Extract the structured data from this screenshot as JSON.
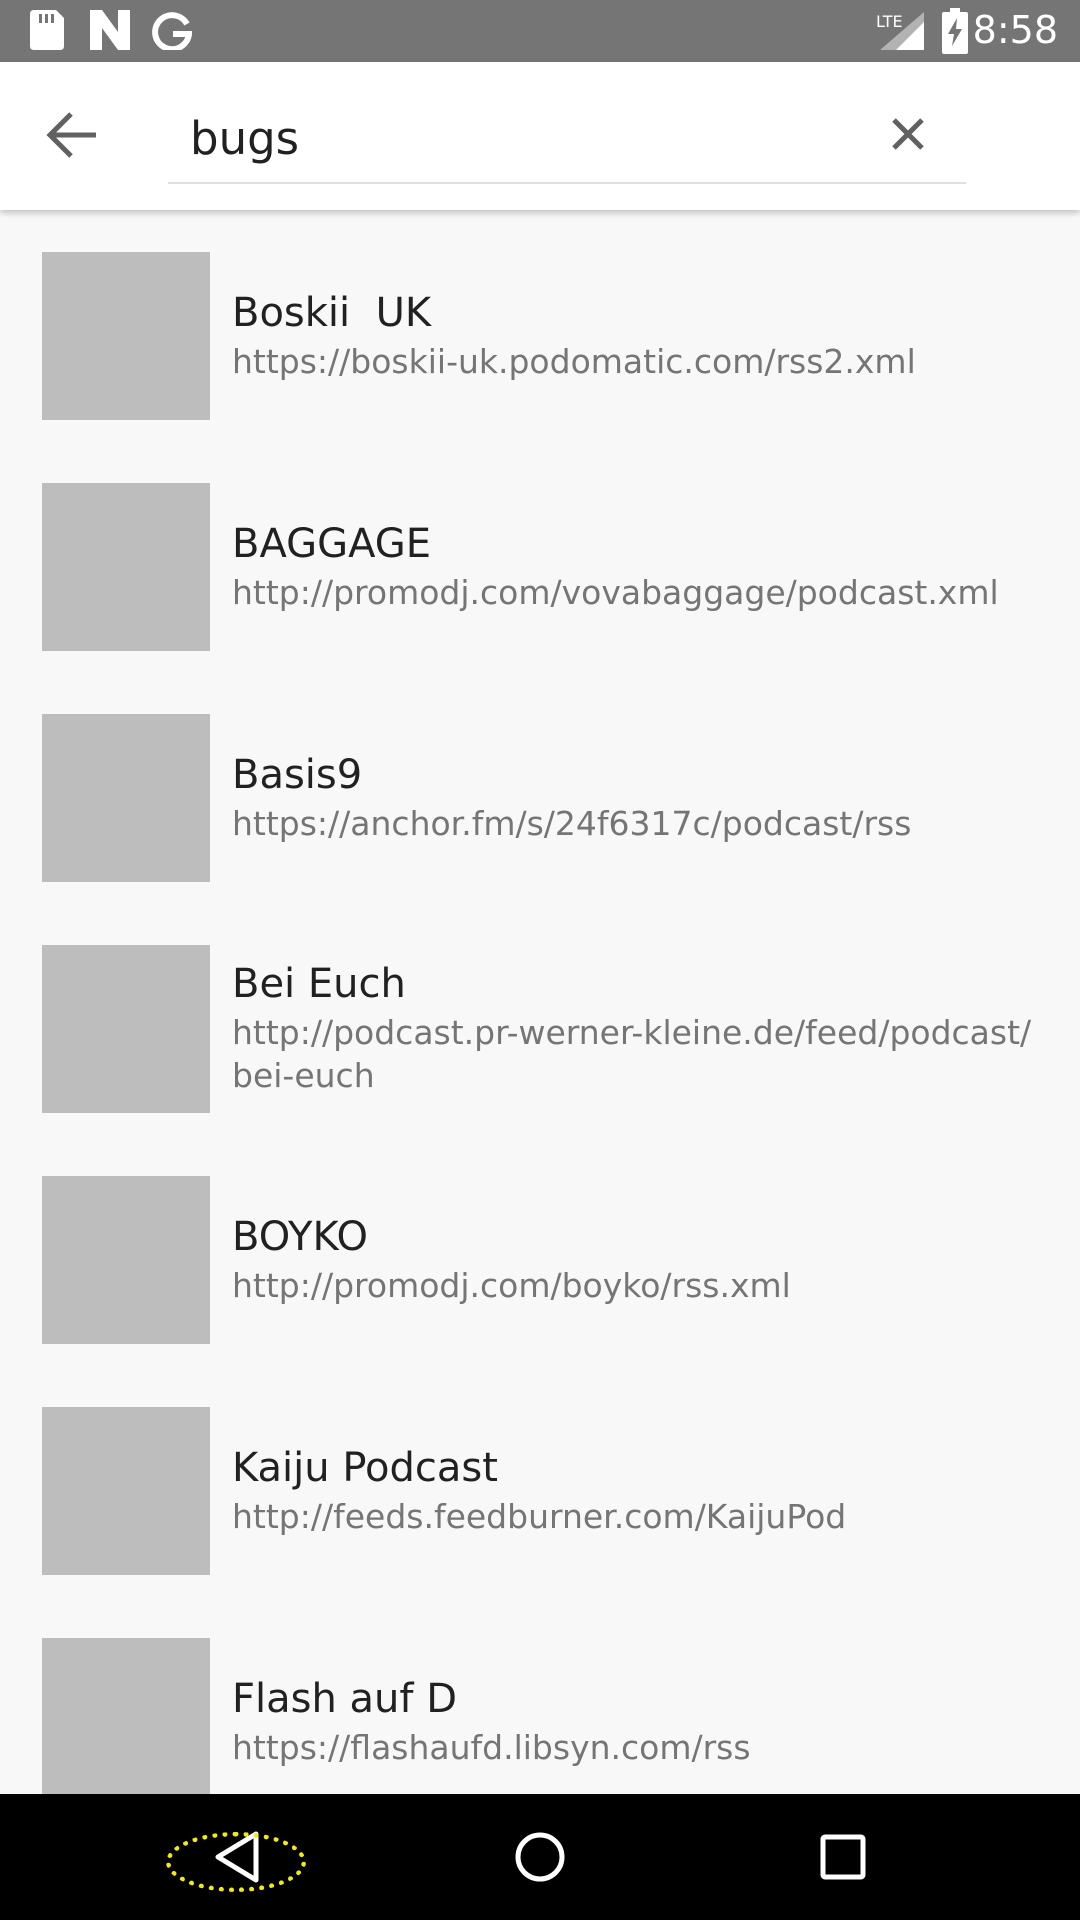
{
  "status_bar": {
    "time": "8:58",
    "network": "LTE",
    "left_icons": [
      "sd-card-icon",
      "n-notification-icon",
      "google-icon"
    ],
    "right_icons": [
      "signal-icon",
      "battery-charging-icon"
    ]
  },
  "search": {
    "query": "bugs",
    "back_icon": "arrow-back-icon",
    "clear_icon": "close-icon"
  },
  "results": [
    {
      "title": "Boskii  UK",
      "url": "https://boskii-uk.podomatic.com/rss2.xml"
    },
    {
      "title": "BAGGAGE",
      "url": "http://promodj.com/vovabaggage/podcast.xml"
    },
    {
      "title": "Basis9",
      "url": "https://anchor.fm/s/24f6317c/podcast/rss"
    },
    {
      "title": "Bei Euch",
      "url": "http://podcast.pr-werner-kleine.de/feed/podcast/bei-euch"
    },
    {
      "title": "BOYKO",
      "url": "http://promodj.com/boyko/rss.xml"
    },
    {
      "title": "Kaiju Podcast",
      "url": "http://feeds.feedburner.com/KaijuPod"
    },
    {
      "title": "Flash auf D",
      "url": "https://flashaufd.libsyn.com/rss"
    }
  ],
  "nav_bar": {
    "buttons": [
      "nav-back-icon",
      "nav-home-icon",
      "nav-recents-icon"
    ]
  },
  "colors": {
    "status_bar": "#757575",
    "thumbnail_placeholder": "#bdbdbd",
    "highlight": "#f2ec0e"
  }
}
